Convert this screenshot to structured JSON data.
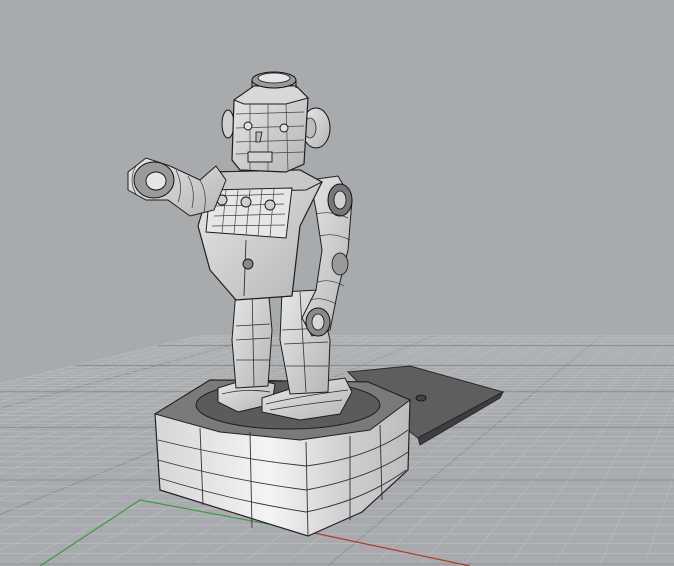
{
  "viewport": {
    "view": "perspective",
    "display_mode": "wireframe-shaded",
    "background_color": "#a8abae",
    "grid": {
      "visible": true,
      "minor_line_color": "#b9bcbf",
      "major_line_color": "#8f9295"
    },
    "axes": {
      "x_axis_color": "#b23a2e",
      "y_axis_color": "#3a9a3a"
    },
    "model": {
      "name": "robot",
      "parts": [
        "head",
        "ears",
        "torso",
        "left-arm",
        "right-arm",
        "legs",
        "feet",
        "turntable-base",
        "ramp-plate"
      ]
    }
  }
}
